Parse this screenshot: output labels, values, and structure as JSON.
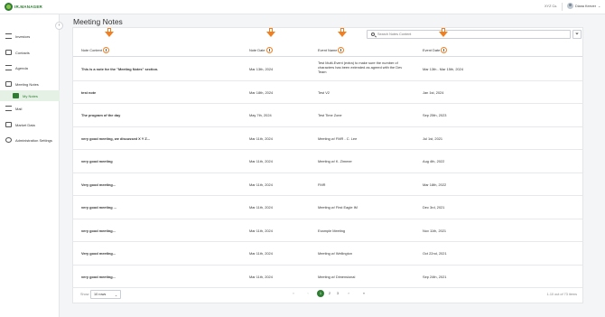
{
  "app": {
    "brand": "IR.MANAGER",
    "company": "XYZ Co.",
    "user_name": "Diana Keever"
  },
  "sidebar": {
    "items": [
      {
        "label": "Investors",
        "icon": "investors-icon"
      },
      {
        "label": "Contacts",
        "icon": "contacts-icon"
      },
      {
        "label": "Agenda",
        "icon": "agenda-icon"
      },
      {
        "label": "Meeting Notes",
        "icon": "meeting-notes-icon"
      },
      {
        "label": "My Notes",
        "icon": "my-notes-icon"
      },
      {
        "label": "Mail",
        "icon": "mail-icon"
      },
      {
        "label": "Market Data",
        "icon": "market-data-icon"
      },
      {
        "label": "Administration Settings",
        "icon": "admin-settings-icon"
      }
    ]
  },
  "page": {
    "title": "Meeting Notes",
    "search_placeholder": "Search Notes Content"
  },
  "table": {
    "columns": [
      "Note Content",
      "Note Date",
      "Event Name",
      "Event Date"
    ],
    "rows": [
      {
        "content": "This is a note for the \"Meeting Notes\" section.",
        "note_date": "Mar 13th, 2024",
        "event": "Test Multi-Event (extra) to make sure the number of characters has been extended as agreed with the Dev Team",
        "event_date": "Mar 13th - Mar 15th, 2024"
      },
      {
        "content": "test note",
        "note_date": "Mar 18th, 2024",
        "event": "Test V2",
        "event_date": "Jan 1st, 2024"
      },
      {
        "content": "The program of the day",
        "note_date": "May 7th, 2024",
        "event": "Test Time Zone",
        "event_date": "Sep 25th, 2023"
      },
      {
        "content": "very good meeting, we discussed X Y Z...",
        "note_date": "Mar 11th, 2024",
        "event": "Meeting w/ FMR - C. Lee",
        "event_date": "Jul 1st, 2021"
      },
      {
        "content": "very good meeting",
        "note_date": "Mar 11th, 2024",
        "event": "Meeting w/ K. Zimmer",
        "event_date": "Aug 4th, 2022"
      },
      {
        "content": "Very good meeting...",
        "note_date": "Mar 11th, 2024",
        "event": "FMR",
        "event_date": "Mar 18th, 2022"
      },
      {
        "content": "very good meeting ...",
        "note_date": "Mar 11th, 2024",
        "event": "Meeting w/ First Eagle IM",
        "event_date": "Dec 3rd, 2021"
      },
      {
        "content": "very good meeting...",
        "note_date": "Mar 11th, 2024",
        "event": "Example Meeting",
        "event_date": "Nov 11th, 2021"
      },
      {
        "content": "Very good meeting...",
        "note_date": "Mar 11th, 2024",
        "event": "Meeting w/ Wellington",
        "event_date": "Oct 22nd, 2021"
      },
      {
        "content": "very good meeting...",
        "note_date": "Mar 11th, 2024",
        "event": "Meeting w/ Dimensional",
        "event_date": "Sep 24th, 2021"
      }
    ]
  },
  "pager": {
    "show_label": "Show",
    "page_size": "10 rows",
    "pages": [
      "1",
      "2",
      "3"
    ],
    "current_page": "1",
    "count_text": "1-10 out of 73 items"
  },
  "colors": {
    "accent": "#2e7d32",
    "annotation": "#f07f21"
  }
}
